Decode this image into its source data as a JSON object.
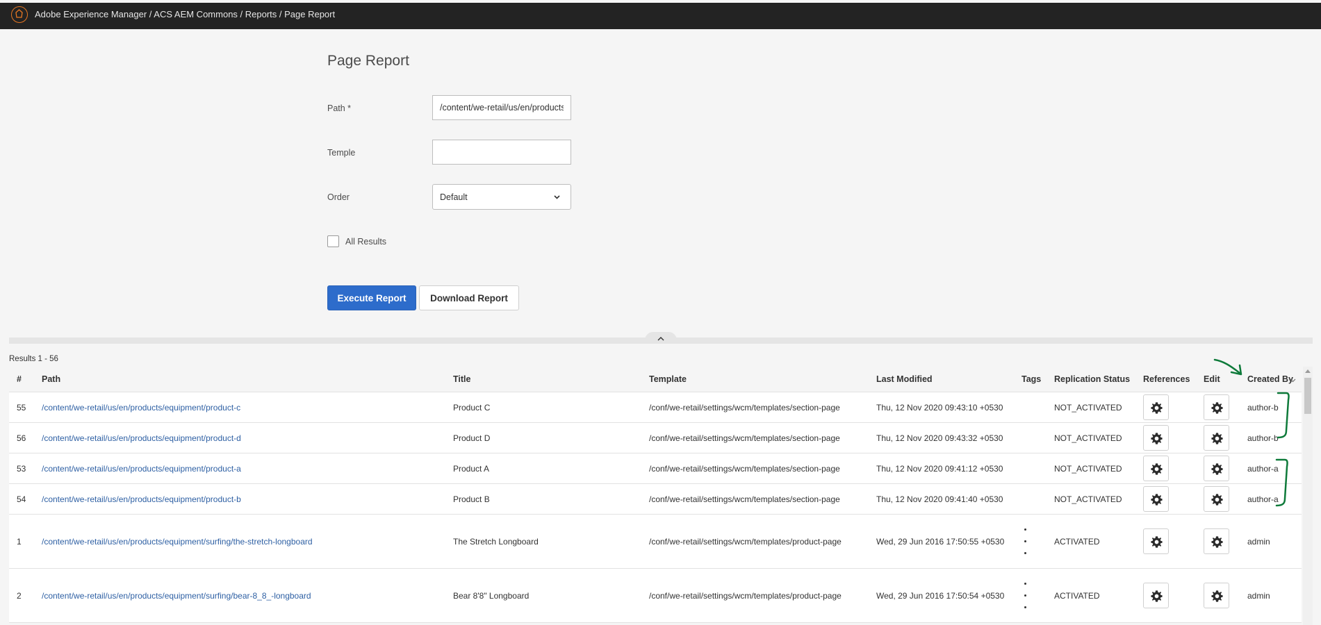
{
  "header": {
    "breadcrumb": "Adobe Experience Manager / ACS AEM Commons / Reports / Page Report"
  },
  "form": {
    "title": "Page Report",
    "path_label": "Path *",
    "path_value": "/content/we-retail/us/en/products",
    "template_label": "Temple",
    "template_value": "",
    "order_label": "Order",
    "order_value": "Default",
    "all_results_label": "All Results",
    "all_results_checked": false,
    "execute_label": "Execute Report",
    "download_label": "Download Report"
  },
  "results": {
    "count_label": "Results 1 - 56",
    "columns": [
      "#",
      "Path",
      "Title",
      "Template",
      "Last Modified",
      "Tags",
      "Replication Status",
      "References",
      "Edit",
      "Created By"
    ],
    "rows": [
      {
        "num": "55",
        "path": "/content/we-retail/us/en/products/equipment/product-c",
        "title": "Product C",
        "template": "/conf/we-retail/settings/wcm/templates/section-page",
        "modified": "Thu, 12 Nov 2020 09:43:10 +0530",
        "tags": false,
        "status": "NOT_ACTIVATED",
        "created_by": "author-b"
      },
      {
        "num": "56",
        "path": "/content/we-retail/us/en/products/equipment/product-d",
        "title": "Product D",
        "template": "/conf/we-retail/settings/wcm/templates/section-page",
        "modified": "Thu, 12 Nov 2020 09:43:32 +0530",
        "tags": false,
        "status": "NOT_ACTIVATED",
        "created_by": "author-b"
      },
      {
        "num": "53",
        "path": "/content/we-retail/us/en/products/equipment/product-a",
        "title": "Product A",
        "template": "/conf/we-retail/settings/wcm/templates/section-page",
        "modified": "Thu, 12 Nov 2020 09:41:12 +0530",
        "tags": false,
        "status": "NOT_ACTIVATED",
        "created_by": "author-a"
      },
      {
        "num": "54",
        "path": "/content/we-retail/us/en/products/equipment/product-b",
        "title": "Product B",
        "template": "/conf/we-retail/settings/wcm/templates/section-page",
        "modified": "Thu, 12 Nov 2020 09:41:40 +0530",
        "tags": false,
        "status": "NOT_ACTIVATED",
        "created_by": "author-a"
      },
      {
        "num": "1",
        "path": "/content/we-retail/us/en/products/equipment/surfing/the-stretch-longboard",
        "title": "The Stretch Longboard",
        "template": "/conf/we-retail/settings/wcm/templates/product-page",
        "modified": "Wed, 29 Jun 2016 17:50:55 +0530",
        "tags": true,
        "status": "ACTIVATED",
        "created_by": "admin"
      },
      {
        "num": "2",
        "path": "/content/we-retail/us/en/products/equipment/surfing/bear-8_8_-longboard",
        "title": "Bear 8'8\" Longboard",
        "template": "/conf/we-retail/settings/wcm/templates/product-page",
        "modified": "Wed, 29 Jun 2016 17:50:54 +0530",
        "tags": true,
        "status": "ACTIVATED",
        "created_by": "admin"
      }
    ]
  },
  "colors": {
    "topbar": "#232323",
    "primary": "#2d6ccb",
    "link": "#2d5fa3",
    "annotation": "#0e7a3a"
  },
  "icons": {
    "logo": "adobe-logo-icon",
    "select": "chevron-down-icon",
    "collapse": "chevron-up-icon",
    "references": "gear-icon",
    "edit": "gear-icon",
    "sort": "sort-icon"
  }
}
